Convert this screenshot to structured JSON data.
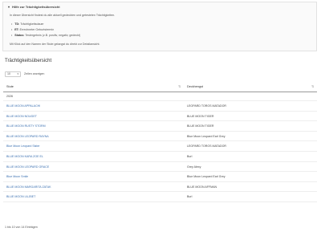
{
  "help": {
    "title": "Hilfe zur Trächtigkeitsübersicht",
    "intro": "In dieser Übersicht findest du alle aktuell gedeckten und getesteten Trächtigkeiten.",
    "items": [
      {
        "term": "TD:",
        "text": "Trächtigkeitsdauer"
      },
      {
        "term": "ET:",
        "text": "Errechneter Geburtstermin"
      },
      {
        "term": "Status:",
        "text": "Testergebnis (z.B. positiv, negativ, gedeckt)"
      }
    ],
    "note": "Mit Klick auf den Namen der Stute gelangst du direkt zur Detailansicht."
  },
  "section_title": "Trächtigkeitsübersicht",
  "length_menu": {
    "value": "10",
    "label": "Zeilen anzeigen"
  },
  "table": {
    "headers": [
      "Stute",
      "Deckhengst"
    ],
    "group": "2026",
    "rows": [
      {
        "mare": "BLUE MOON APPALACHI",
        "stallion": "LEOPARD TOROS MATADOR"
      },
      {
        "mare": "BLUE MOON NOUGET",
        "stallion": "BLUE MOON TIGER"
      },
      {
        "mare": "BLUE MOON RUSTY STORM",
        "stallion": "BLUE MOON TIGER"
      },
      {
        "mare": "BLUE MOON LEOPARD RAYNA",
        "stallion": "Blue Moon Leopard Earl Grey"
      },
      {
        "mare": "Blue Moon Leopard Sister",
        "stallion": "LEOPARD TOROS MATADOR"
      },
      {
        "mare": "BLUE MOON KARA ZOE EL",
        "stallion": "Burl"
      },
      {
        "mare": "BLUE MOON LEOPARD GRACE",
        "stallion": "Grey Alexy"
      },
      {
        "mare": "Blue Moon Smile",
        "stallion": "Blue Moon Leopard Earl Grey"
      },
      {
        "mare": "BLUE MOON MARGARITA ZATAK",
        "stallion": "BLUE MOON AFFMAN"
      },
      {
        "mare": "BLUE MOON LILJBET",
        "stallion": "Burl"
      }
    ]
  },
  "footer": "1 bis 10 von 14 Einträgen"
}
